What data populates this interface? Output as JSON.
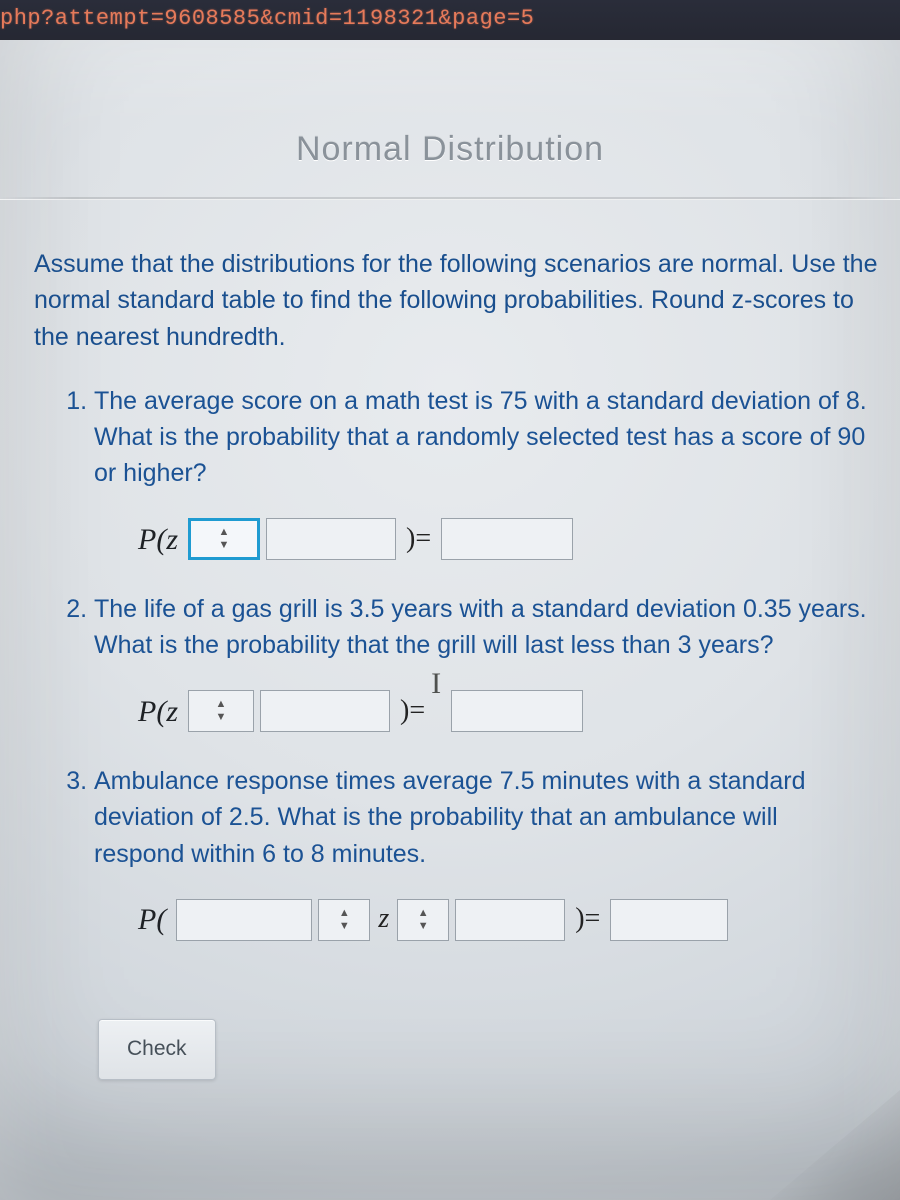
{
  "url_fragment": "php?attempt=9608585&cmid=1198321&page=5",
  "header_faded": "Normal Distribution",
  "intro": "Assume that the distributions for the following scenarios are normal. Use the normal standard table to find the following probabilities. Round z-scores to the nearest hundredth.",
  "questions": {
    "q1": "The average score on a math test is 75 with a standard deviation of 8. What is the probability that a randomly selected test has a score of 90 or higher?",
    "q2": "The life of a gas grill is 3.5 years with a standard deviation 0.35 years. What is the probability that the grill will last less than 3 years?",
    "q3": "Ambulance response times average 7.5 minutes with a standard deviation of 2.5. What is the probability that an ambulance will respond within 6 to 8 minutes."
  },
  "labels": {
    "pz": "P(z",
    "p_open": "P(",
    "close_eq": ")=",
    "z": "z"
  },
  "check_button": "Check",
  "icons": {
    "cursor": "I"
  }
}
